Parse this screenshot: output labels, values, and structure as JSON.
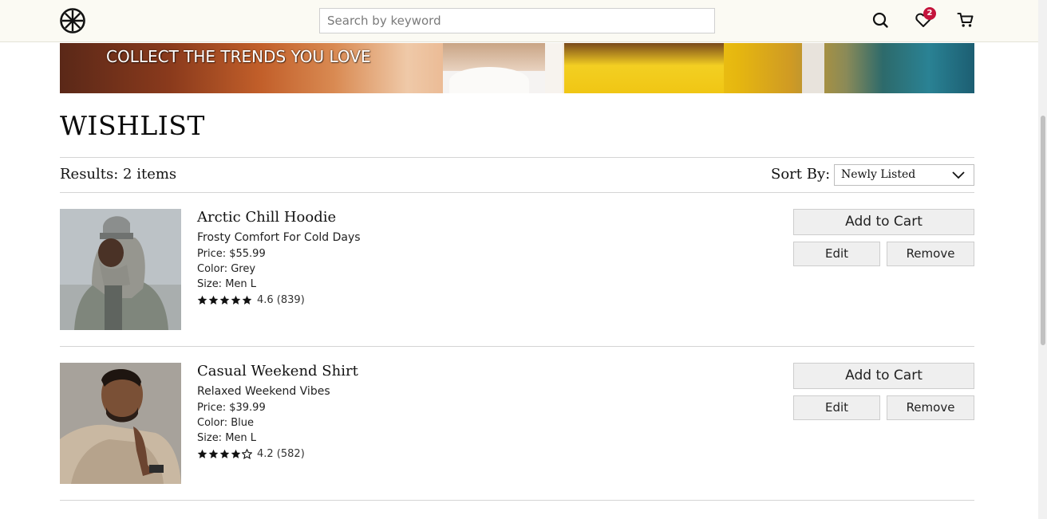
{
  "header": {
    "search_placeholder": "Search by keyword",
    "wishlist_count": "2"
  },
  "banner": {
    "text": "COLLECT THE TRENDS YOU LOVE"
  },
  "page": {
    "title": "WISHLIST",
    "results": "Results: 2 items",
    "sort_label": "Sort By:",
    "sort_value": "Newly Listed"
  },
  "items": [
    {
      "name": "Arctic Chill Hoodie",
      "tagline": "Frosty Comfort For Cold Days",
      "price": "Price: $55.99",
      "color": "Color: Grey",
      "size": "Size: Men L",
      "stars": 4.6,
      "rating_text": "4.6 (839)",
      "add_to_cart": "Add to Cart",
      "edit": "Edit",
      "remove": "Remove"
    },
    {
      "name": "Casual Weekend Shirt",
      "tagline": "Relaxed Weekend Vibes",
      "price": "Price: $39.99",
      "color": "Color: Blue",
      "size": "Size: Men L",
      "stars": 4.2,
      "rating_text": "4.2 (582)",
      "add_to_cart": "Add to Cart",
      "edit": "Edit",
      "remove": "Remove"
    }
  ],
  "colors": {
    "header_bg": "#fbfaf3",
    "badge": "#c4133b",
    "button_bg": "#efefef"
  },
  "icons": [
    "logo-wheel-icon",
    "search-icon",
    "heart-icon",
    "cart-icon",
    "chevron-down-icon",
    "star-icon"
  ]
}
